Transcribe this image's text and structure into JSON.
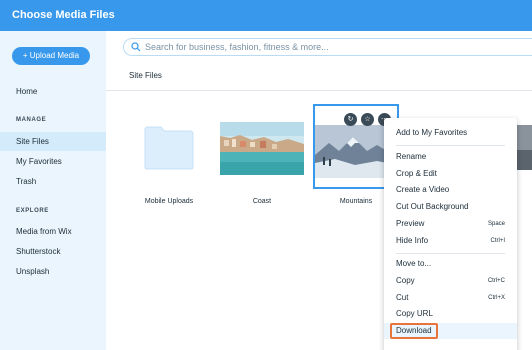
{
  "header": {
    "title": "Choose Media Files"
  },
  "sidebar": {
    "upload_label": "+ Upload Media",
    "home": "Home",
    "manage_heading": "MANAGE",
    "manage_items": [
      "Site Files",
      "My Favorites",
      "Trash"
    ],
    "explore_heading": "EXPLORE",
    "explore_items": [
      "Media from Wix",
      "Shutterstock",
      "Unsplash"
    ]
  },
  "search": {
    "placeholder": "Search for business, fashion, fitness & more..."
  },
  "breadcrumb": "Site Files",
  "files": [
    {
      "name": "Mobile Uploads",
      "kind": "folder"
    },
    {
      "name": "Coast",
      "kind": "image"
    },
    {
      "name": "Mountains",
      "kind": "image"
    }
  ],
  "context_menu": {
    "items": [
      {
        "label": "Add to My Favorites"
      },
      {
        "label": "Rename"
      },
      {
        "label": "Crop & Edit"
      },
      {
        "label": "Create a Video"
      },
      {
        "label": "Cut Out Background"
      },
      {
        "label": "Preview",
        "shortcut": "Space"
      },
      {
        "label": "Hide Info",
        "shortcut": "Ctrl+I"
      },
      {
        "label": "Move to..."
      },
      {
        "label": "Copy",
        "shortcut": "Ctrl+C"
      },
      {
        "label": "Cut",
        "shortcut": "Ctrl+X"
      },
      {
        "label": "Copy URL"
      },
      {
        "label": "Download"
      }
    ]
  },
  "colors": {
    "accent": "#3899ec",
    "sidebar_bg": "#eaf5fd",
    "highlight_outline": "#e8743b"
  }
}
